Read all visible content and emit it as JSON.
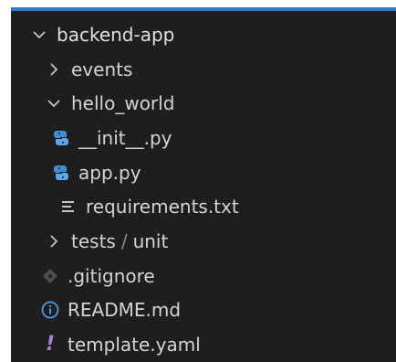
{
  "explorer": {
    "accent_color": "#2b79d0",
    "background": "#1e1e1e",
    "items": [
      {
        "label": "backend-app",
        "type": "folder",
        "expanded": true,
        "icon": "chevron-down-icon"
      },
      {
        "label": "events",
        "type": "folder",
        "expanded": false,
        "icon": "chevron-right-icon"
      },
      {
        "label": "hello_world",
        "type": "folder",
        "expanded": true,
        "icon": "chevron-down-icon"
      },
      {
        "label": "__init__.py",
        "type": "file",
        "icon": "python-file-icon"
      },
      {
        "label": "app.py",
        "type": "file",
        "icon": "python-file-icon"
      },
      {
        "label": "requirements.txt",
        "type": "file",
        "icon": "text-file-icon"
      },
      {
        "label_parts": [
          "tests",
          "/",
          "unit"
        ],
        "type": "folder",
        "expanded": false,
        "icon": "chevron-right-icon"
      },
      {
        "label": ".gitignore",
        "type": "file",
        "icon": "git-file-icon"
      },
      {
        "label": "README.md",
        "type": "file",
        "icon": "info-icon"
      },
      {
        "label": "template.yaml",
        "type": "file",
        "icon": "yaml-exclamation-icon",
        "glyph": "!"
      }
    ]
  }
}
